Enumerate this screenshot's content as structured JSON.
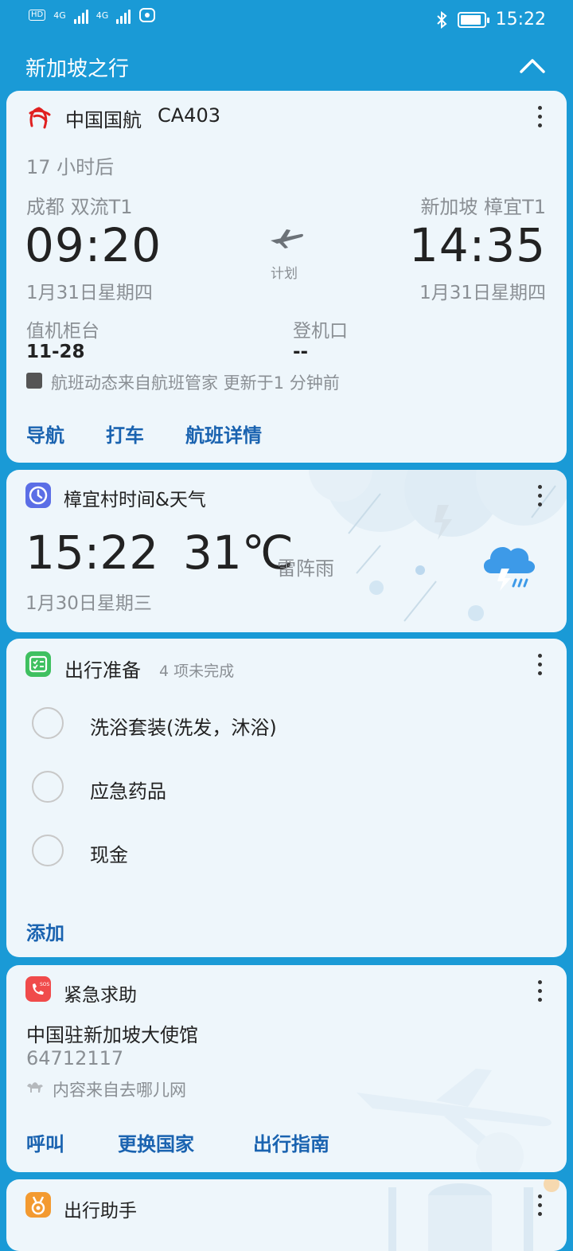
{
  "status_bar": {
    "network_1": "4G",
    "network_2": "4G",
    "time": "15:22",
    "battery_level": 0.9
  },
  "header": {
    "title": "新加坡之行"
  },
  "flight": {
    "airline": "中国国航",
    "flight_no": "CA403",
    "countdown": "17 小时后",
    "departure": {
      "airport": "成都 双流T1",
      "time": "09:20",
      "date": "1月31日星期四"
    },
    "arrival": {
      "airport": "新加坡 樟宜T1",
      "time": "14:35",
      "date": "1月31日星期四"
    },
    "status": "计划",
    "checkin_label": "值机柜台",
    "checkin_value": "11-28",
    "gate_label": "登机口",
    "gate_value": "--",
    "source": "航班动态来自航班管家 更新于1 分钟前",
    "actions": [
      "导航",
      "打车",
      "航班详情"
    ]
  },
  "weather": {
    "title": "樟宜村时间&天气",
    "time": "15:22",
    "temperature": "31℃",
    "condition": "雷阵雨",
    "date": "1月30日星期三"
  },
  "prep": {
    "title": "出行准备",
    "count": "4 项未完成",
    "items": [
      "洗浴套装(洗发，沐浴)",
      "应急药品",
      "现金"
    ],
    "add_label": "添加"
  },
  "sos": {
    "title": "紧急求助",
    "place": "中国驻新加坡大使馆",
    "phone": "64712117",
    "source": "内容来自去哪儿网",
    "actions": [
      "呼叫",
      "更换国家",
      "出行指南"
    ]
  },
  "assistant": {
    "title": "出行助手"
  },
  "colors": {
    "background": "#1a9ad6",
    "card": "#eef6fb",
    "action": "#1a63b0",
    "airline_red": "#e02020"
  }
}
